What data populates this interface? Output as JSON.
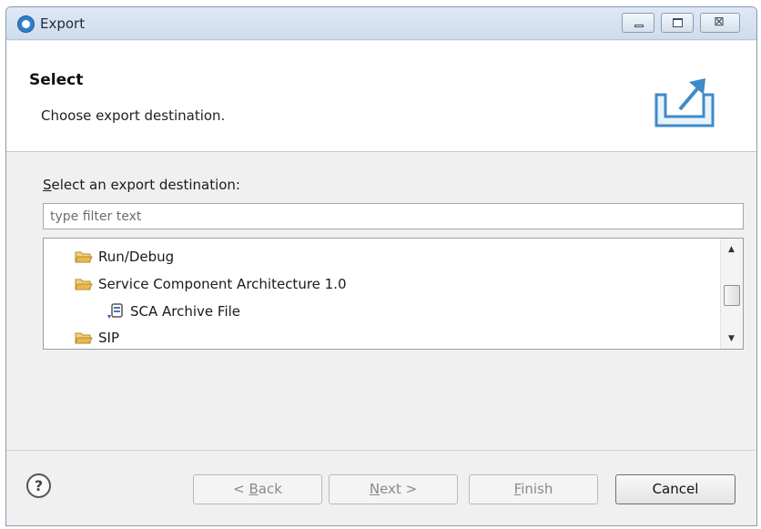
{
  "window": {
    "title": "Export",
    "controls": {
      "minimize": "minimize",
      "maximize": "maximize",
      "close_glyph": "⊠"
    }
  },
  "header": {
    "title": "Select",
    "description": "Choose export destination.",
    "icon": "export-wizard-icon"
  },
  "destination": {
    "label_mnemonic": "S",
    "label_rest": "elect an export destination:",
    "filter_placeholder": "type filter text"
  },
  "tree": {
    "items": [
      {
        "label": "Run/Debug",
        "icon": "folder-open-icon",
        "level": 1
      },
      {
        "label": "Service Component Architecture 1.0",
        "icon": "folder-open-icon",
        "level": 1
      },
      {
        "label": "SCA Archive File",
        "icon": "sca-archive-icon",
        "level": 2
      },
      {
        "label": "SIP",
        "icon": "folder-open-icon",
        "level": 1
      }
    ],
    "scrollbar": {
      "up": "▲",
      "down": "▼"
    }
  },
  "buttons": {
    "help": "?",
    "back_prefix": "< ",
    "back_mnemonic": "B",
    "back_rest": "ack",
    "next_mnemonic": "N",
    "next_rest": "ext >",
    "finish_mnemonic": "F",
    "finish_rest": "inish",
    "cancel": "Cancel"
  },
  "colors": {
    "titlebar": "#dfe9f5",
    "dialog_bg": "#f0f0f0",
    "folder": "#e8b94a",
    "accent": "#2f7fc8"
  }
}
